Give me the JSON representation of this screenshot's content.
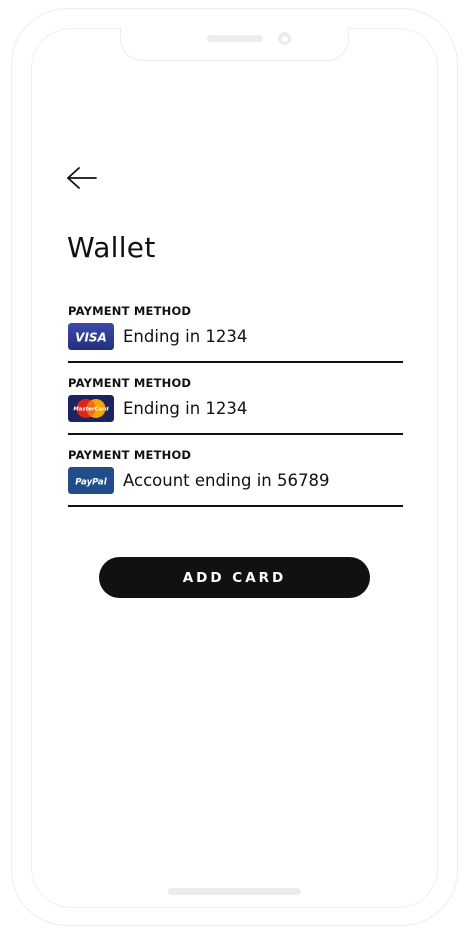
{
  "header": {
    "back_icon": "arrow-left-icon",
    "title": "Wallet"
  },
  "payment_methods": [
    {
      "label": "PAYMENT METHOD",
      "brand": "VISA",
      "logo_icon": "visa-logo-icon",
      "description": "Ending in 1234"
    },
    {
      "label": "PAYMENT METHOD",
      "brand": "MasterCard",
      "logo_icon": "mastercard-logo-icon",
      "description": "Ending in 1234"
    },
    {
      "label": "PAYMENT METHOD",
      "brand": "PayPal",
      "logo_icon": "paypal-logo-icon",
      "description": "Account ending in 56789"
    }
  ],
  "actions": {
    "add_card_label": "ADD CARD"
  },
  "colors": {
    "text": "#111111",
    "button_bg": "#111111",
    "button_text": "#ffffff",
    "visa_blue": "#2b3990",
    "paypal_blue": "#1f4e8a"
  }
}
